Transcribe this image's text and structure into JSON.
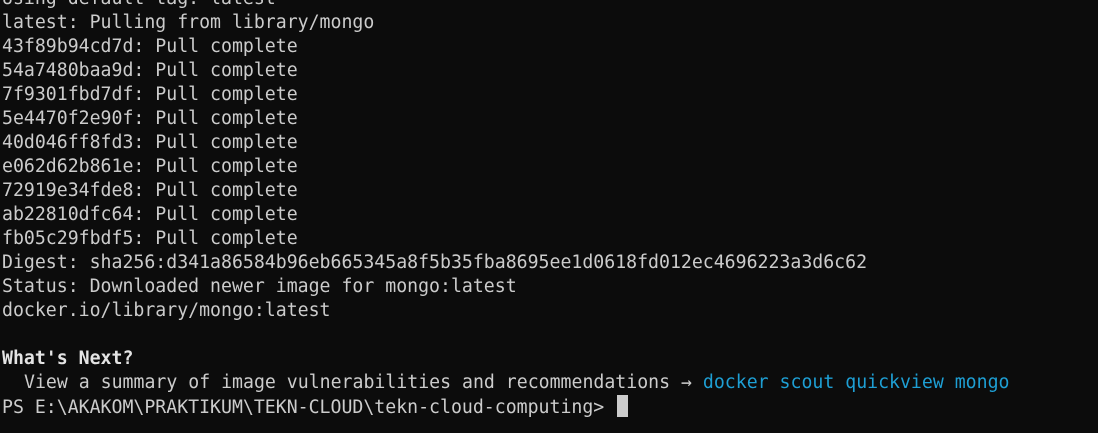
{
  "colors": {
    "background": "#0c0c0c",
    "foreground": "#cccccc",
    "command_link": "#1e9fd4"
  },
  "terminal": {
    "lines": [
      "Using default tag: latest",
      "latest: Pulling from library/mongo",
      "43f89b94cd7d: Pull complete",
      "54a7480baa9d: Pull complete",
      "7f9301fbd7df: Pull complete",
      "5e4470f2e90f: Pull complete",
      "40d046ff8fd3: Pull complete",
      "e062d62b861e: Pull complete",
      "72919e34fde8: Pull complete",
      "ab22810dfc64: Pull complete",
      "fb05c29fbdf5: Pull complete",
      "Digest: sha256:d341a86584b96eb665345a8f5b35fba8695ee1d0618fd012ec4696223a3d6c62",
      "Status: Downloaded newer image for mongo:latest",
      "docker.io/library/mongo:latest"
    ],
    "whats_next": {
      "heading": "What's Next?",
      "hint_text": "View a summary of image vulnerabilities and recommendations → ",
      "hint_command": "docker scout quickview mongo"
    },
    "prompt": "PS E:\\AKAKOM\\PRAKTIKUM\\TEKN-CLOUD\\tekn-cloud-computing> "
  }
}
